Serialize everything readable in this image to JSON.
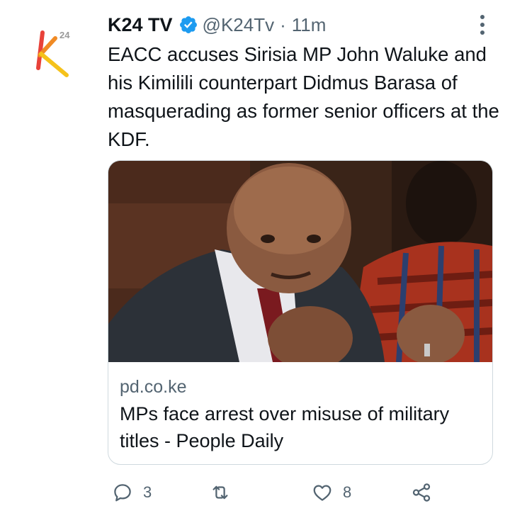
{
  "tweet": {
    "display_name": "K24 TV",
    "handle": "@K24Tv",
    "separator": "·",
    "time_ago": "11m",
    "text": "EACC accuses Sirisia MP John Waluke and his Kimilili counterpart Didmus Barasa of masquerading as former senior officers at the KDF.",
    "verified": true,
    "avatar_icon": "k24-logo-icon",
    "avatar_logo_text": "K 24"
  },
  "card": {
    "domain": "pd.co.ke",
    "title": "MPs face arrest over misuse of military titles - People Daily",
    "image_icon": "article-photo"
  },
  "actions": {
    "reply_count": "3",
    "retweet_count": "",
    "like_count": "8"
  },
  "colors": {
    "text_primary": "#0f1419",
    "text_secondary": "#536471",
    "verified_blue": "#1d9bf0",
    "card_border": "#cfd9de"
  }
}
